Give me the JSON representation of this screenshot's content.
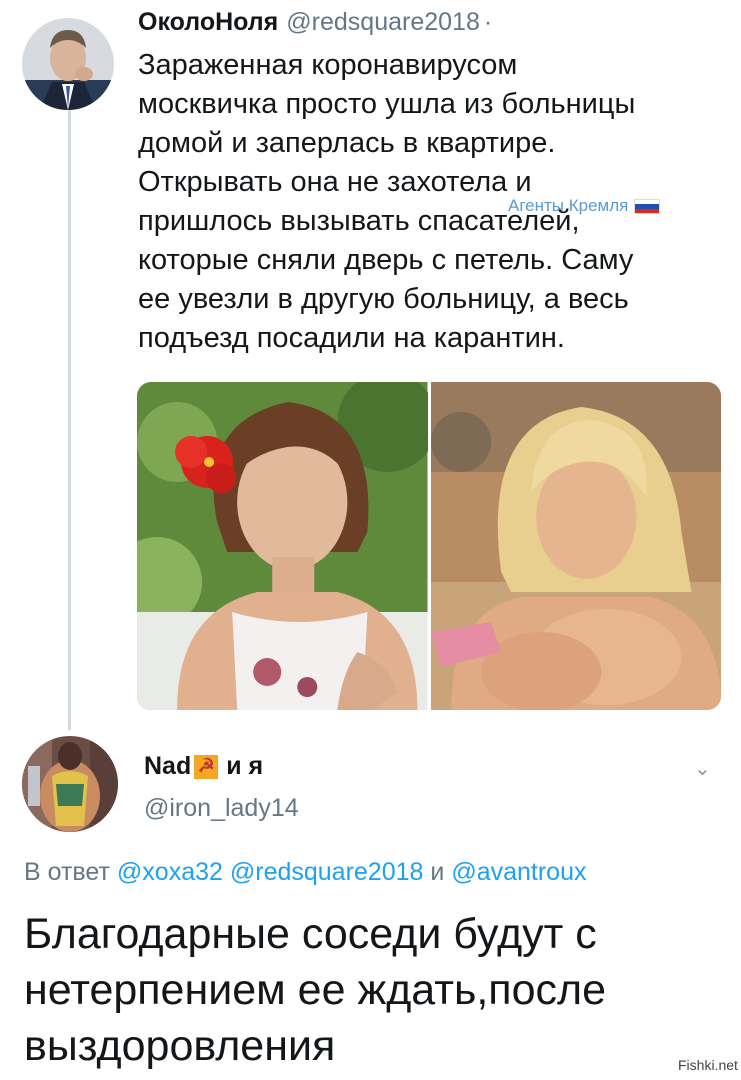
{
  "tweet1": {
    "display_name": "ОколоНоля",
    "handle": "@redsquare2018",
    "separator": "·",
    "lines": [
      "Зараженная коронавирусом",
      "москвичка просто ушла из больницы",
      "домой и заперлась в квартире.",
      "Открывать она не захотела и",
      "пришлось вызывать спасателей,",
      "которые сняли дверь с петель. Саму",
      "ее увезли в другую больницу, а весь",
      "подъезд посадили на карантин."
    ],
    "watermark": "Агенты Кремля",
    "flag_colors": [
      "#ffffff",
      "#1f4fb4",
      "#d52b1e"
    ]
  },
  "tweet2": {
    "display_name_pre": "Nad",
    "display_name_symbol": "☭",
    "display_name_post": "и я",
    "handle": "@iron_lady14",
    "chevron": "⌄",
    "reply_prefix": "В ответ",
    "mentions": [
      "@xoxa32",
      "@redsquare2018"
    ],
    "reply_conjunction": "и",
    "last_mention": "@avantroux",
    "text": "Благодарные соседи будут  с нетерпением ее ждать,после выздоровления"
  },
  "site_mark": "Fishki.net",
  "colors": {
    "link": "#1da1f2",
    "muted": "#657786",
    "thread_line": "#cfd9de"
  }
}
